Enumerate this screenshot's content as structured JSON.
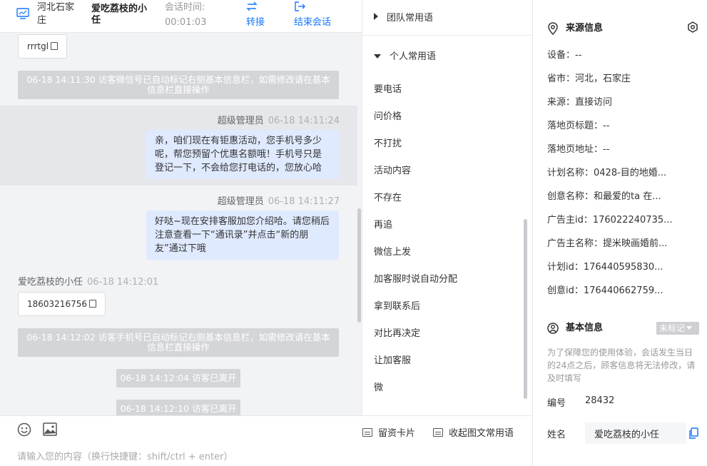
{
  "header": {
    "location": "河北石家庄",
    "visitor_name": "爱吃荔枝的小任",
    "session_time_label": "会话时间:",
    "session_time": "00:01:03",
    "transfer_label": "转接",
    "end_session_label": "结束会话"
  },
  "chat": {
    "file_bubble_1": "rrrtgl",
    "sys_1": "06-18 14:11:30 访客微信号已自动标记右侧基本信息栏，如需修改请在基本信息栏直接操作",
    "msg_1": {
      "sender": "超级管理员",
      "time": "06-18 14:11:24",
      "text": "亲，咱们现在有钜惠活动，您手机号多少呢，帮您预留个优惠名额哦！手机号只是登记一下，不会给您打电话的，您放心哈"
    },
    "msg_2": {
      "sender": "超级管理员",
      "time": "06-18 14:11:27",
      "text": "好哒~现在安排客服加您介绍哈。请您稍后注意查看一下“通讯录”并点击“新的朋友”通过下哦"
    },
    "msg_3": {
      "sender": "爱吃荔枝的小任",
      "time": "06-18 14:12:01"
    },
    "file_bubble_2": "18603216756",
    "sys_2": "06-18 14:12:02 访客手机号已自动标记右侧基本信息栏，如需修改请在基本信息栏直接操作",
    "sys_3": "06-18 14:12:04 访客已离开",
    "sys_4": "06-18 14:12:10 访客已离开"
  },
  "input": {
    "card_label": "留资卡片",
    "collapse_label": "收起图文常用语",
    "placeholder": "请输入您的内容（换行快捷键：shift/ctrl + enter）"
  },
  "phrases": {
    "team_label": "团队常用语",
    "personal_label": "个人常用语",
    "items": [
      "要电话",
      "问价格",
      "不打扰",
      "活动内容",
      "不存在",
      "再追",
      "微信上发",
      "加客服时说自动分配",
      "拿到联系后",
      "对比再决定",
      "让加客服",
      "微"
    ]
  },
  "info": {
    "source_title": "来源信息",
    "device": "设备：--",
    "province_city": "省市：河北，石家庄",
    "source": "来源：直接访问",
    "landing_title": "落地页标题：--",
    "landing_url": "落地页地址：--",
    "plan_name": "计划名称：0428-目的地婚...",
    "creative_name": "创意名称：和最爱的ta 在...",
    "advertiser_id": "广告主id：176022240735...",
    "advertiser_name": "广告主名称：提米映画婚前...",
    "plan_id": "计划id：176440595830...",
    "creative_id": "创意id：176440662759...",
    "basic_title": "基本信息",
    "unmarked_tag": "未标记",
    "notice": "为了保障您的使用体验，会话发生当日的24点之后，顾客信息将无法修改，请及时填写",
    "number_label": "编号",
    "number_value": "28432",
    "name_label": "姓名",
    "name_value": "爱吃荔枝的小任"
  },
  "colors": {
    "accent": "#1677ff",
    "agent_bubble": "#dfeaff",
    "system_msg": "#d4d5d8"
  }
}
